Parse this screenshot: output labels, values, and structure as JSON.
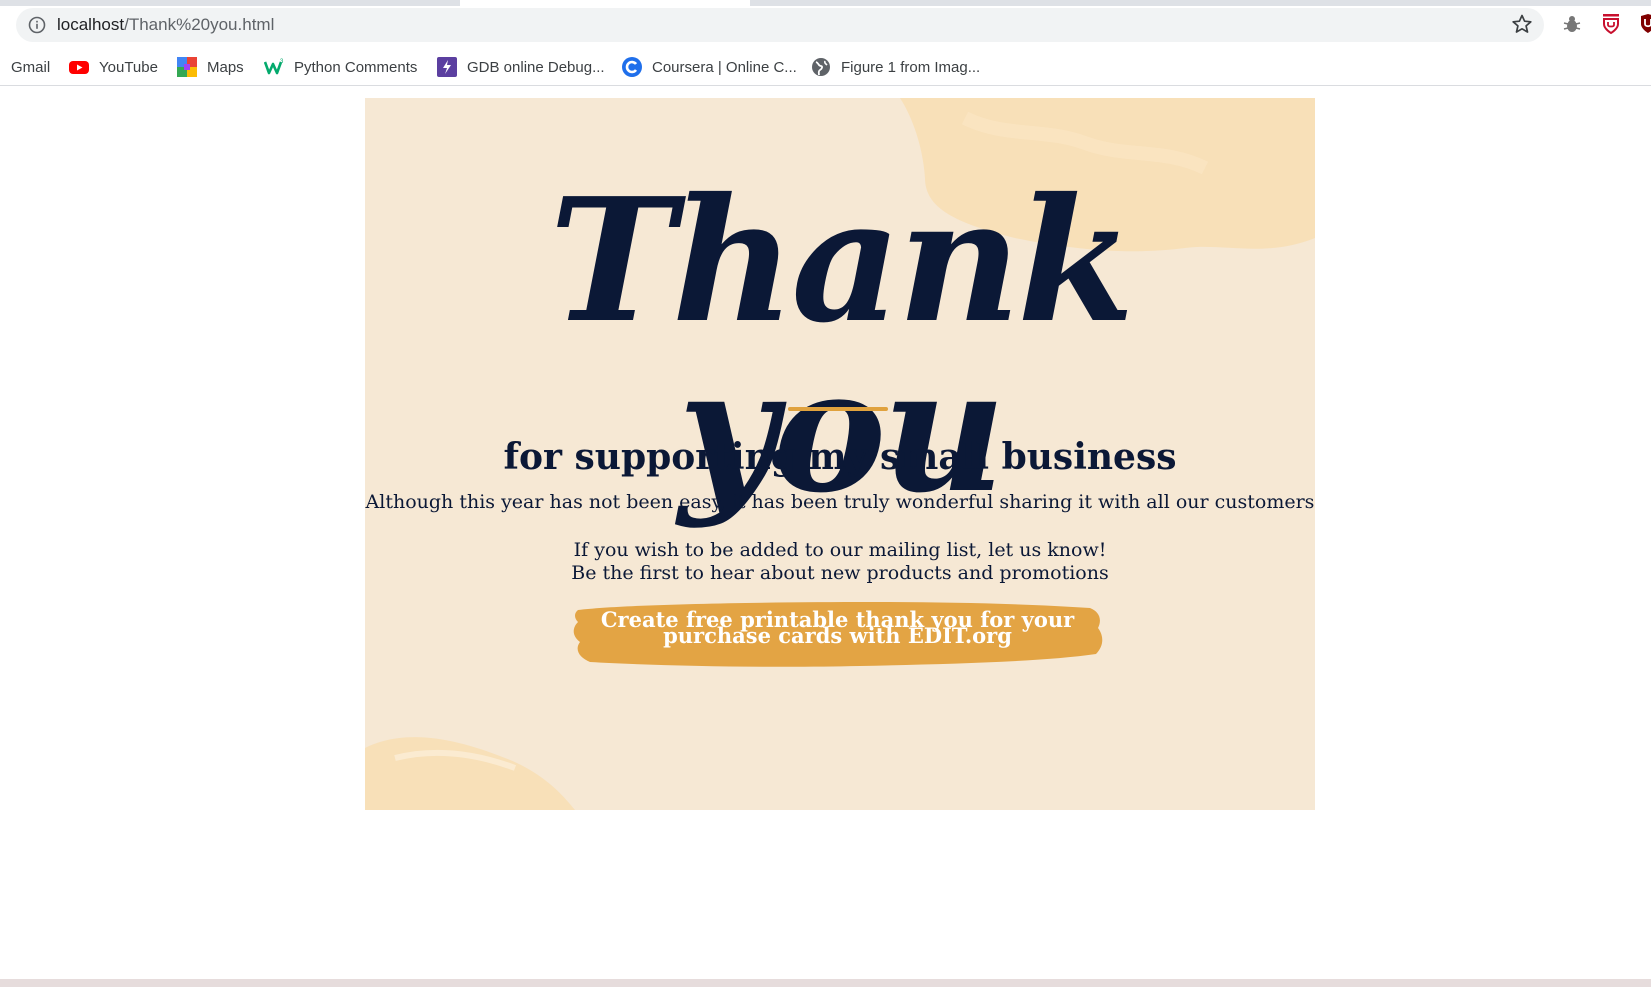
{
  "browser": {
    "url_host": "localhost",
    "url_path": "/Thank%20you.html",
    "icons": [
      "info-icon",
      "star-icon",
      "bug-extension-icon",
      "shield-extension-icon"
    ]
  },
  "bookmarks": [
    {
      "label": "Gmail",
      "icon": "none"
    },
    {
      "label": "YouTube",
      "icon": "youtube-icon"
    },
    {
      "label": "Maps",
      "icon": "maps-icon"
    },
    {
      "label": "Python Comments",
      "icon": "w3schools-icon"
    },
    {
      "label": "GDB online Debug...",
      "icon": "gdb-icon"
    },
    {
      "label": "Coursera | Online C...",
      "icon": "coursera-icon"
    },
    {
      "label": "Figure 1 from Imag...",
      "icon": "globe-icon"
    }
  ],
  "card": {
    "heading": "Thank you",
    "subtitle": "for supporting my small business",
    "line1": "Although this year has not been easy, it has been truly wonderful sharing it with all our customers",
    "line2": "If you wish to be added to our mailing list, let us know!",
    "line3": "Be the first to hear about new products and promotions",
    "cta_line1": "Create free printable thank you for your",
    "cta_line2": "purchase cards with EDIT.org"
  },
  "colors": {
    "card_background": "#f6e8d4",
    "text_navy": "#0b1836",
    "accent_orange": "#e0a23e",
    "brush_light": "#f8deb3"
  }
}
